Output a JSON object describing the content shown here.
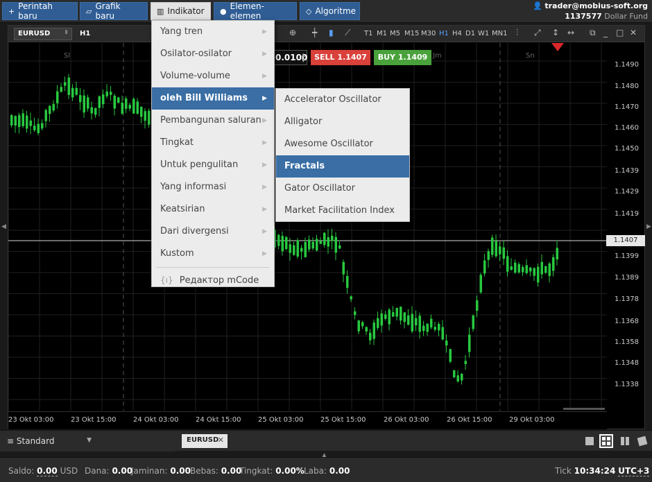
{
  "toolbar": {
    "new_order": "Perintah baru",
    "new_chart": "Grafik baru",
    "indicators": "Indikator",
    "elements": "Elemen-elemen",
    "algorithms": "Algoritme"
  },
  "account": {
    "email": "trader@mobius-soft.org",
    "number": "1137577",
    "fund": "Dollar Fund"
  },
  "chart": {
    "symbol": "EURUSD",
    "timeframe": "H1",
    "timeframes": [
      "T1",
      "M1",
      "M5",
      "M15",
      "M30",
      "H1",
      "H4",
      "D1",
      "W1",
      "MN1"
    ],
    "selected_timeframe": "H1",
    "lot": "0.0100",
    "sell_label": "SELL",
    "sell_price": "1.1407",
    "buy_label": "BUY",
    "buy_price": "1.1409",
    "current_price": "1.1407",
    "day_labels": [
      "Sl",
      "Jm",
      "Sn"
    ],
    "y_ticks": [
      "1.1490",
      "1.1480",
      "1.1470",
      "1.1460",
      "1.1450",
      "1.1439",
      "1.1429",
      "1.1419",
      "1.1399",
      "1.1389",
      "1.1378",
      "1.1368",
      "1.1358",
      "1.1348",
      "1.1338"
    ],
    "x_ticks": [
      "23 Okt 03:00",
      "23 Okt 15:00",
      "24 Okt 03:00",
      "24 Okt 15:00",
      "25 Okt 03:00",
      "25 Okt 15:00",
      "26 Okt 03:00",
      "26 Okt 15:00",
      "29 Okt 03:00"
    ],
    "colors": {
      "up": "#27c93f",
      "down": "#27c93f",
      "sell": "#d9413a",
      "buy": "#4aa23c"
    }
  },
  "menu": {
    "items": [
      {
        "label": "Yang tren"
      },
      {
        "label": "Osilator-osilator"
      },
      {
        "label": "Volume-volume"
      },
      {
        "label": "oleh Bill Williams"
      },
      {
        "label": "Pembangunan saluran"
      },
      {
        "label": "Tingkat"
      },
      {
        "label": "Untuk pengulitan"
      },
      {
        "label": "Yang informasi"
      },
      {
        "label": "Keatsirian"
      },
      {
        "label": "Dari divergensi"
      },
      {
        "label": "Kustom"
      }
    ],
    "code_label": "Редактор mCode",
    "highlighted": "oleh Bill Williams"
  },
  "submenu": {
    "items": [
      {
        "label": "Accelerator Oscillator"
      },
      {
        "label": "Alligator"
      },
      {
        "label": "Awesome Oscillator"
      },
      {
        "label": "Fractals"
      },
      {
        "label": "Gator Oscillator"
      },
      {
        "label": "Market Facilitation Index"
      }
    ],
    "highlighted": "Fractals"
  },
  "tabs": {
    "layout": "Standard",
    "open_tab": "EURUSD"
  },
  "status": {
    "saldo_label": "Saldo:",
    "saldo_value": "0.00",
    "saldo_ccy": "USD",
    "dana_label": "Dana:",
    "dana_value": "0.00",
    "jaminan_label": "Jaminan:",
    "jaminan_value": "0.00",
    "bebas_label": "Bebas:",
    "bebas_value": "0.00",
    "tingkat_label": "Tingkat:",
    "tingkat_value": "0.00%",
    "laba_label": "Laba:",
    "laba_value": "0.00",
    "tick_label": "Tick",
    "time": "10:34:24",
    "tz": "UTC+3"
  }
}
